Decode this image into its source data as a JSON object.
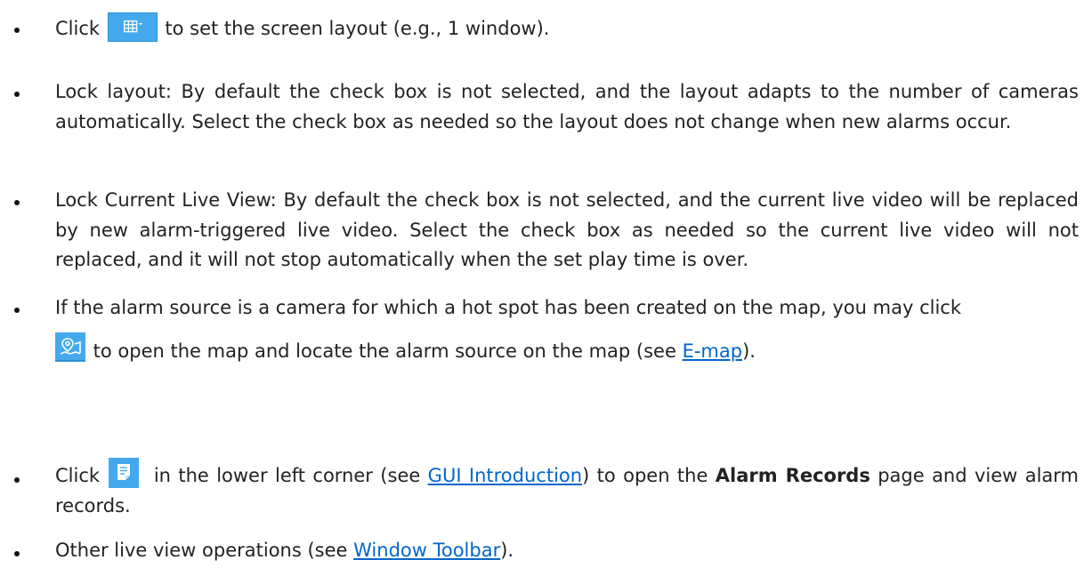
{
  "items": [
    {
      "before": "Click ",
      "icon": "grid-layout-icon",
      "after": " to set the screen layout (e.g., 1 window)."
    },
    {
      "text": "Lock layout: By default the check box is not selected, and the layout adapts to the number of cameras automatically. Select the check box as needed so the layout does not change when new alarms occur."
    },
    {
      "text": "Lock Current Live View: By default the check box is not selected, and the current live video will be replaced by new alarm-triggered live video. Select the check box as needed so the current live video will not replaced, and it will not stop automatically when the set play time is over."
    },
    {
      "line1": "If the alarm source is a camera for which a hot spot has been created on the map, you may click",
      "icon": "map-locate-icon",
      "line2_after_icon": " to open the map and locate the alarm source on the map (see ",
      "link": "E-map",
      "tail": ")."
    },
    {
      "before": "Click ",
      "icon": "alarm-records-icon",
      "middle": " in the lower left corner (see ",
      "link": "GUI Introduction",
      "after_link": ") to open the ",
      "bold": "Alarm Records",
      "after_bold": " page and view alarm records."
    },
    {
      "before": "Other live view operations (see ",
      "link": "Window Toolbar",
      "after": ")."
    }
  ],
  "colors": {
    "link": "#0066cc",
    "icon_bg": "#43a9ec"
  }
}
